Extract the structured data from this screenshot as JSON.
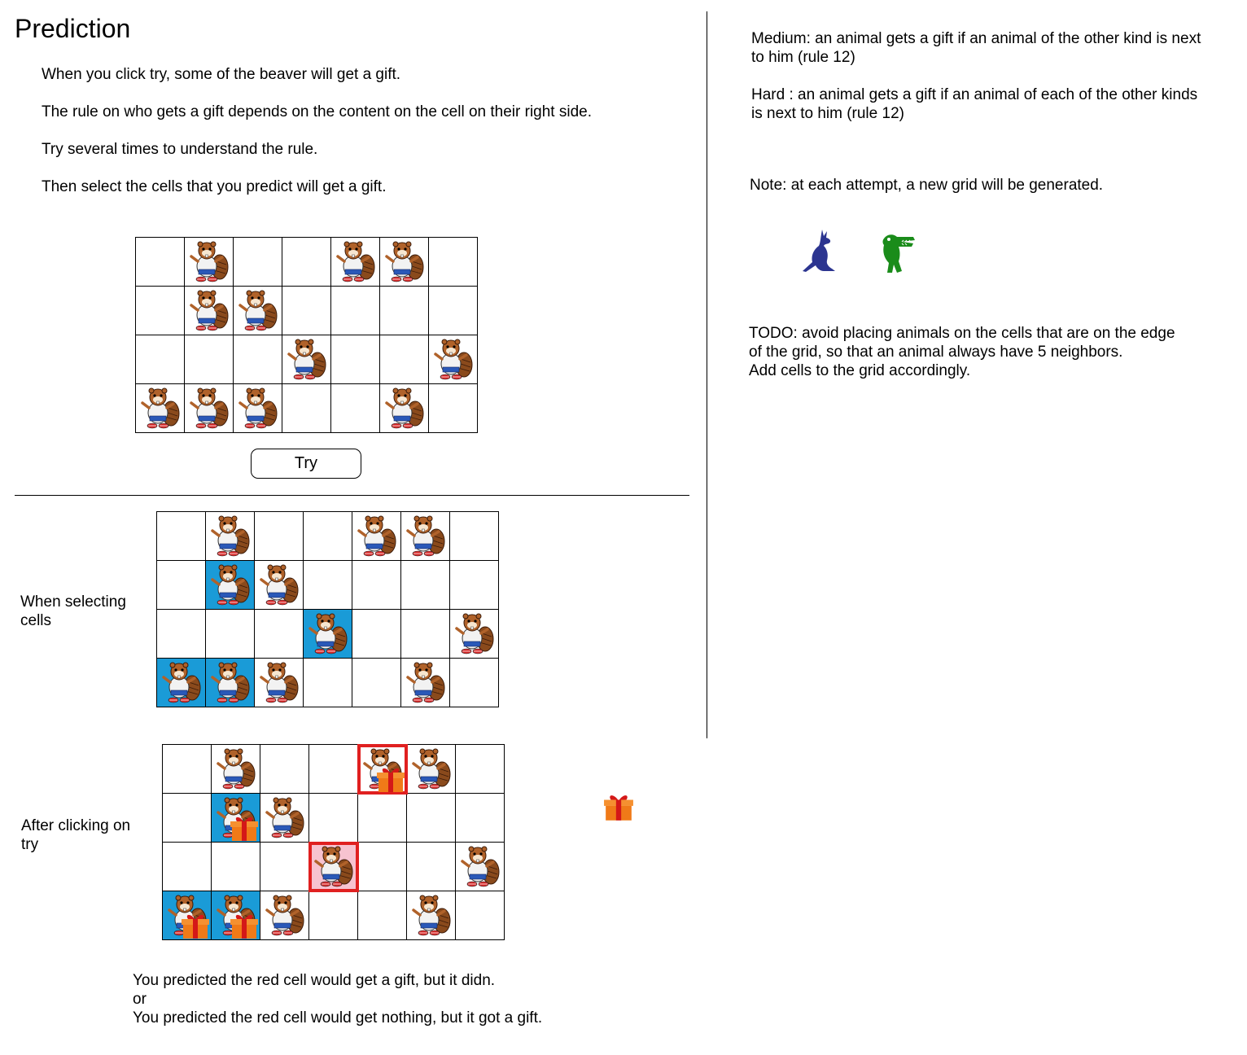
{
  "title": "Prediction",
  "instructions": [
    "When you click try, some of the beaver will get a gift.",
    "The rule on who gets a gift depends on the content on the cell on their right side.",
    "Try several times to understand the rule.",
    "Then select the cells that you predict will get a gift."
  ],
  "try_button": "Try",
  "notes": {
    "medium_line1": "Medium: an animal gets a gift if an animal of the other kind is next",
    "medium_line2": "to him (rule 12)",
    "hard_line1": "Hard : an animal gets a gift if an animal of each of the other kinds",
    "hard_line2": "is next to him (rule 12)",
    "note": "Note: at each attempt, a new grid will be generated.",
    "todo_line1": "TODO: avoid placing animals on the cells that are on the edge",
    "todo_line2": "of the grid, so that an animal always have 5 neighbors.",
    "todo_line3": "Add cells to the grid accordingly."
  },
  "animal_icons": [
    "kangaroo-icon",
    "crocodile-icon"
  ],
  "colors": {
    "selected": "#1a9bd7",
    "wrong_highlight": "#e02020",
    "wrong_fill": "#f7c3d0",
    "kangaroo": "#2c3590",
    "crocodile": "#1a8c1a",
    "gift": "#f08020",
    "ribbon": "#d41818"
  },
  "labels": {
    "selecting_line1": "When selecting",
    "selecting_line2": "cells",
    "after_line1": "After clicking on",
    "after_line2": "try"
  },
  "grid_rows": 4,
  "grid_cols": 7,
  "beaver_cells": [
    "0,1",
    "0,4",
    "0,5",
    "1,1",
    "1,2",
    "2,3",
    "2,6",
    "3,0",
    "3,1",
    "3,2",
    "3,5"
  ],
  "grids": {
    "main": {
      "selected": [],
      "gifts": [],
      "red": [],
      "pink": []
    },
    "selecting": {
      "selected": [
        "1,1",
        "2,3",
        "3,0",
        "3,1"
      ],
      "gifts": [],
      "red": [],
      "pink": []
    },
    "after": {
      "selected": [
        "1,1",
        "3,0",
        "3,1"
      ],
      "gifts": [
        "0,4",
        "1,1",
        "3,0",
        "3,1"
      ],
      "red": [
        "0,4",
        "2,3"
      ],
      "pink": [
        "2,3"
      ]
    }
  },
  "feedback": {
    "line1": "You predicted the red cell would get a gift, but it didn.",
    "line2": "or",
    "line3": "You predicted the red cell would get nothing, but it got a gift."
  }
}
